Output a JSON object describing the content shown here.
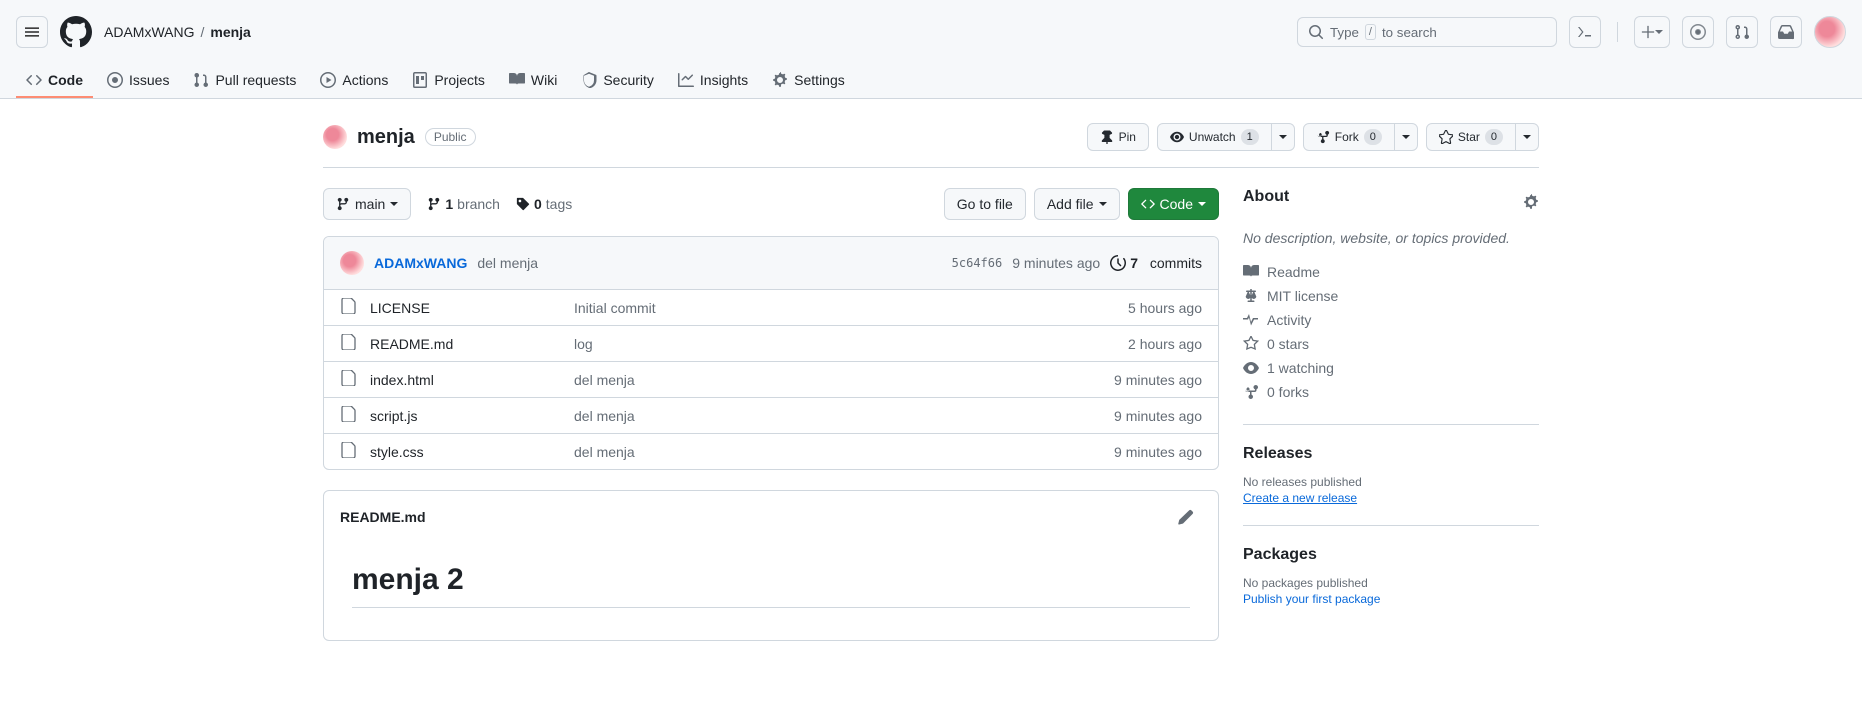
{
  "header": {
    "owner": "ADAMxWANG",
    "repo": "menja",
    "search_placeholder": "Type",
    "search_placeholder_after": "to search",
    "slash_key": "/"
  },
  "tabs": [
    {
      "label": "Code"
    },
    {
      "label": "Issues"
    },
    {
      "label": "Pull requests"
    },
    {
      "label": "Actions"
    },
    {
      "label": "Projects"
    },
    {
      "label": "Wiki"
    },
    {
      "label": "Security"
    },
    {
      "label": "Insights"
    },
    {
      "label": "Settings"
    }
  ],
  "repo": {
    "name": "menja",
    "visibility": "Public",
    "pin": "Pin",
    "unwatch": "Unwatch",
    "watch_count": "1",
    "fork": "Fork",
    "fork_count": "0",
    "star": "Star",
    "star_count": "0"
  },
  "filenav": {
    "branch": "main",
    "branches_n": "1",
    "branches_t": "branch",
    "tags_n": "0",
    "tags_t": "tags",
    "go_to_file": "Go to file",
    "add_file": "Add file",
    "code": "Code"
  },
  "commitbar": {
    "author": "ADAMxWANG",
    "message": "del menja",
    "sha": "5c64f66",
    "time": "9 minutes ago",
    "count_n": "7",
    "count_t": "commits"
  },
  "files": [
    {
      "name": "LICENSE",
      "msg": "Initial commit",
      "time": "5 hours ago"
    },
    {
      "name": "README.md",
      "msg": "log",
      "time": "2 hours ago"
    },
    {
      "name": "index.html",
      "msg": "del menja",
      "time": "9 minutes ago"
    },
    {
      "name": "script.js",
      "msg": "del menja",
      "time": "9 minutes ago"
    },
    {
      "name": "style.css",
      "msg": "del menja",
      "time": "9 minutes ago"
    }
  ],
  "readme": {
    "filename": "README.md",
    "heading": "menja 2"
  },
  "about": {
    "title": "About",
    "description": "No description, website, or topics provided.",
    "readme": "Readme",
    "license": "MIT license",
    "activity": "Activity",
    "stars": "0 stars",
    "watching": "1 watching",
    "forks": "0 forks"
  },
  "releases": {
    "title": "Releases",
    "none": "No releases published",
    "create": "Create a new release"
  },
  "packages": {
    "title": "Packages",
    "none": "No packages published",
    "publish": "Publish your first package"
  }
}
